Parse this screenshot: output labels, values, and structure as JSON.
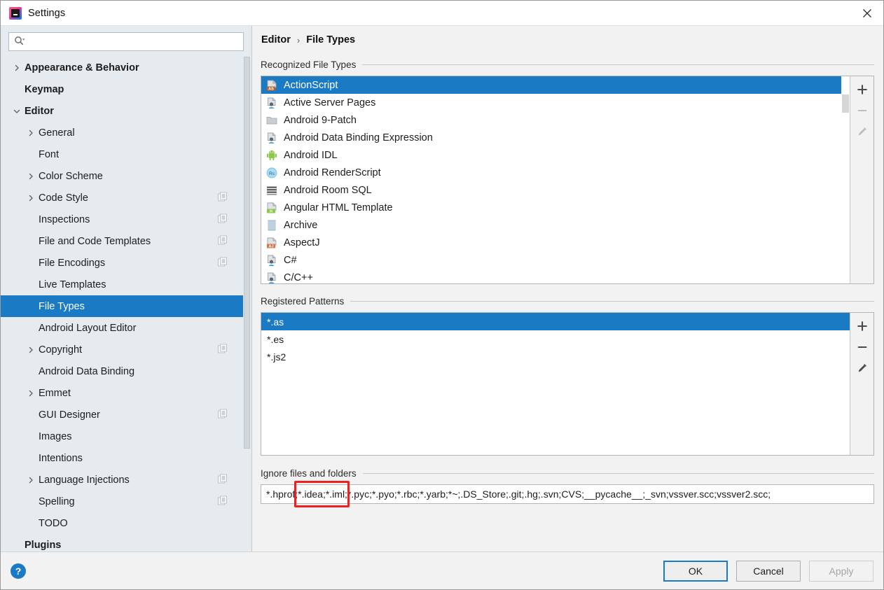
{
  "window": {
    "title": "Settings",
    "app_icon": "intellij-idea-logo-icon",
    "close_icon": "close-icon"
  },
  "search": {
    "value": "",
    "placeholder": "",
    "icon": "search-icon"
  },
  "sidebar": {
    "items": [
      {
        "label": "Appearance & Behavior",
        "level": 0,
        "arrow": "chevron-right",
        "bold": true,
        "selected": false,
        "config": false
      },
      {
        "label": "Keymap",
        "level": 0,
        "arrow": "none",
        "bold": true,
        "selected": false,
        "config": false
      },
      {
        "label": "Editor",
        "level": 0,
        "arrow": "chevron-down",
        "bold": true,
        "selected": false,
        "config": false
      },
      {
        "label": "General",
        "level": 1,
        "arrow": "chevron-right",
        "bold": false,
        "selected": false,
        "config": false
      },
      {
        "label": "Font",
        "level": 1,
        "arrow": "none",
        "bold": false,
        "selected": false,
        "config": false
      },
      {
        "label": "Color Scheme",
        "level": 1,
        "arrow": "chevron-right",
        "bold": false,
        "selected": false,
        "config": false
      },
      {
        "label": "Code Style",
        "level": 1,
        "arrow": "chevron-right",
        "bold": false,
        "selected": false,
        "config": true
      },
      {
        "label": "Inspections",
        "level": 1,
        "arrow": "none",
        "bold": false,
        "selected": false,
        "config": true
      },
      {
        "label": "File and Code Templates",
        "level": 1,
        "arrow": "none",
        "bold": false,
        "selected": false,
        "config": true
      },
      {
        "label": "File Encodings",
        "level": 1,
        "arrow": "none",
        "bold": false,
        "selected": false,
        "config": true
      },
      {
        "label": "Live Templates",
        "level": 1,
        "arrow": "none",
        "bold": false,
        "selected": false,
        "config": false
      },
      {
        "label": "File Types",
        "level": 1,
        "arrow": "none",
        "bold": false,
        "selected": true,
        "config": false
      },
      {
        "label": "Android Layout Editor",
        "level": 1,
        "arrow": "none",
        "bold": false,
        "selected": false,
        "config": false
      },
      {
        "label": "Copyright",
        "level": 1,
        "arrow": "chevron-right",
        "bold": false,
        "selected": false,
        "config": true
      },
      {
        "label": "Android Data Binding",
        "level": 1,
        "arrow": "none",
        "bold": false,
        "selected": false,
        "config": false
      },
      {
        "label": "Emmet",
        "level": 1,
        "arrow": "chevron-right",
        "bold": false,
        "selected": false,
        "config": false
      },
      {
        "label": "GUI Designer",
        "level": 1,
        "arrow": "none",
        "bold": false,
        "selected": false,
        "config": true
      },
      {
        "label": "Images",
        "level": 1,
        "arrow": "none",
        "bold": false,
        "selected": false,
        "config": false
      },
      {
        "label": "Intentions",
        "level": 1,
        "arrow": "none",
        "bold": false,
        "selected": false,
        "config": false
      },
      {
        "label": "Language Injections",
        "level": 1,
        "arrow": "chevron-right",
        "bold": false,
        "selected": false,
        "config": true
      },
      {
        "label": "Spelling",
        "level": 1,
        "arrow": "none",
        "bold": false,
        "selected": false,
        "config": true
      },
      {
        "label": "TODO",
        "level": 1,
        "arrow": "none",
        "bold": false,
        "selected": false,
        "config": false
      },
      {
        "label": "Plugins",
        "level": 0,
        "arrow": "none",
        "bold": true,
        "selected": false,
        "config": false
      }
    ]
  },
  "breadcrumb": {
    "parent": "Editor",
    "separator": "›",
    "current": "File Types"
  },
  "recognized": {
    "section_label": "Recognized File Types",
    "rows": [
      {
        "label": "ActionScript",
        "icon": "actionscript-file-icon",
        "selected": true
      },
      {
        "label": "Active Server Pages",
        "icon": "asp-file-icon",
        "selected": false
      },
      {
        "label": "Android 9-Patch",
        "icon": "folder-icon",
        "selected": false
      },
      {
        "label": "Android Data Binding Expression",
        "icon": "asp-file-icon",
        "selected": false
      },
      {
        "label": "Android IDL",
        "icon": "android-robot-icon",
        "selected": false
      },
      {
        "label": "Android RenderScript",
        "icon": "renderscript-icon",
        "selected": false
      },
      {
        "label": "Android Room SQL",
        "icon": "sql-table-icon",
        "selected": false
      },
      {
        "label": "Angular HTML Template",
        "icon": "angular-html-icon",
        "selected": false
      },
      {
        "label": "Archive",
        "icon": "archive-icon",
        "selected": false
      },
      {
        "label": "AspectJ",
        "icon": "aspectj-file-icon",
        "selected": false
      },
      {
        "label": "C#",
        "icon": "asp-file-icon",
        "selected": false
      },
      {
        "label": "C/C++",
        "icon": "asp-file-icon",
        "selected": false
      }
    ],
    "toolbar": [
      {
        "name": "add-file-type-button",
        "icon": "plus-icon",
        "label": "Add",
        "enabled": true
      },
      {
        "name": "remove-file-type-button",
        "icon": "minus-icon",
        "label": "Remove",
        "enabled": false
      },
      {
        "name": "edit-file-type-button",
        "icon": "pencil-icon",
        "label": "Edit",
        "enabled": false
      }
    ]
  },
  "patterns": {
    "section_label": "Registered Patterns",
    "rows": [
      {
        "label": "*.as",
        "selected": true
      },
      {
        "label": "*.es",
        "selected": false
      },
      {
        "label": "*.js2",
        "selected": false
      }
    ],
    "toolbar": [
      {
        "name": "add-pattern-button",
        "icon": "plus-icon",
        "label": "Add",
        "enabled": true
      },
      {
        "name": "remove-pattern-button",
        "icon": "minus-icon",
        "label": "Remove",
        "enabled": true
      },
      {
        "name": "edit-pattern-button",
        "icon": "pencil-icon",
        "label": "Edit",
        "enabled": true
      }
    ]
  },
  "ignore": {
    "section_label": "Ignore files and folders",
    "value": "*.hprof;*.idea;*.iml;*.pyc;*.pyo;*.rbc;*.yarb;*~;.DS_Store;.git;.hg;.svn;CVS;__pycache__;_svn;vssver.scc;vssver2.scc;",
    "highlight_text": "*.idea;*.iml;",
    "highlight_color": "#ef2020"
  },
  "footer": {
    "help_icon": "help-question-icon",
    "help_label": "?",
    "buttons": [
      {
        "label": "OK",
        "name": "ok-button",
        "state": "default"
      },
      {
        "label": "Cancel",
        "name": "cancel-button",
        "state": "normal"
      },
      {
        "label": "Apply",
        "name": "apply-button",
        "state": "disabled"
      }
    ]
  },
  "colors": {
    "selection_blue": "#1a7ac4",
    "sidebar_bg": "#e6ebef",
    "panel_bg": "#f2f2f2",
    "highlight_red": "#ef2020"
  }
}
